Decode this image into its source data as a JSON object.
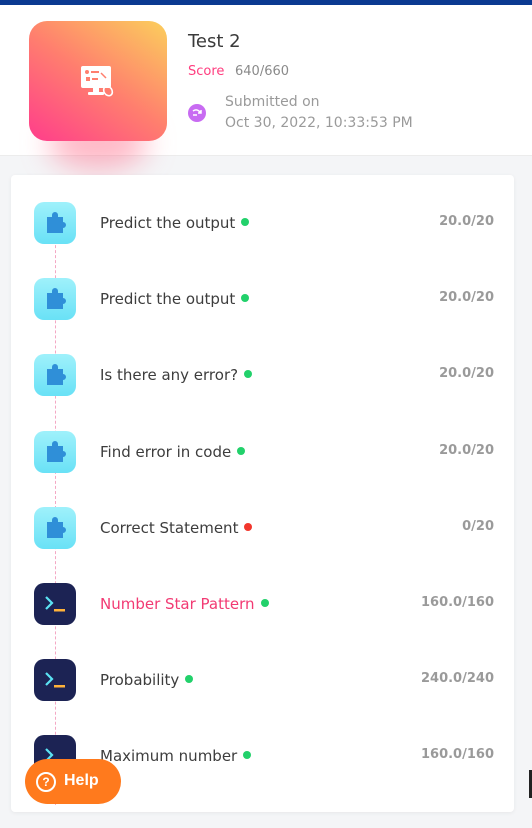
{
  "header": {
    "title": "Test 2",
    "score_label": "Score",
    "score_value": "640/660",
    "submitted_label": "Submitted on",
    "submitted_date": "Oct 30, 2022, 10:33:53 PM",
    "thumbnail_icon": "computer-mouse-icon"
  },
  "questions": [
    {
      "title": "Predict the output",
      "score": "20.0/20",
      "status": "correct",
      "icon": "puzzle-icon"
    },
    {
      "title": "Predict the output",
      "score": "20.0/20",
      "status": "correct",
      "icon": "puzzle-icon"
    },
    {
      "title": "Is there any error?",
      "score": "20.0/20",
      "status": "correct",
      "icon": "puzzle-icon"
    },
    {
      "title": "Find error in code",
      "score": "20.0/20",
      "status": "correct",
      "icon": "puzzle-icon"
    },
    {
      "title": "Correct Statement",
      "score": "0/20",
      "status": "wrong",
      "icon": "puzzle-icon"
    },
    {
      "title": "Number Star Pattern",
      "score": "160.0/160",
      "status": "correct",
      "icon": "terminal-icon",
      "highlighted": true
    },
    {
      "title": "Probability",
      "score": "240.0/240",
      "status": "correct",
      "icon": "terminal-icon"
    },
    {
      "title": "Maximum number",
      "score": "160.0/160",
      "status": "correct",
      "icon": "terminal-icon"
    }
  ],
  "help": {
    "label": "Help",
    "icon": "question-circle-icon"
  },
  "colors": {
    "accent": "#ff3d7f",
    "correct": "#22d16b",
    "wrong": "#f2362c",
    "help": "#ff7a1d",
    "topbar": "#0b3a91"
  }
}
